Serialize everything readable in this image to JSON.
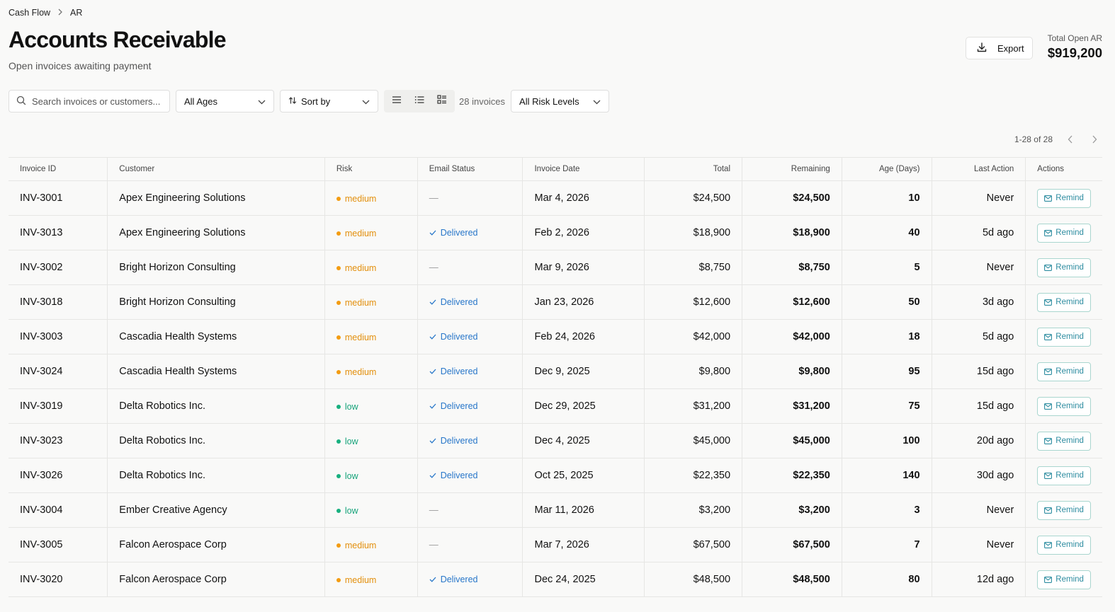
{
  "breadcrumb": {
    "items": [
      "Cash Flow",
      "AR"
    ]
  },
  "header": {
    "title": "Accounts Receivable",
    "subtitle": "Open invoices awaiting payment",
    "export_label": "Export",
    "total_label": "Total Open AR",
    "total_value": "$919,200"
  },
  "toolbar": {
    "search_placeholder": "Search invoices or customers...",
    "age_filter": "All Ages",
    "sort_label": "Sort by",
    "invoice_count": "28 invoices",
    "risk_filter": "All Risk Levels"
  },
  "pagination": {
    "range": "1-28 of 28"
  },
  "table": {
    "columns": [
      "Invoice ID",
      "Customer",
      "Risk",
      "Email Status",
      "Invoice Date",
      "Total",
      "Remaining",
      "Age (Days)",
      "Last Action",
      "Actions"
    ],
    "remind_label": "Remind",
    "rows": [
      {
        "id": "INV-3001",
        "customer": "Apex Engineering Solutions",
        "risk": "medium",
        "email": "—",
        "date": "Mar 4, 2026",
        "total": "$24,500",
        "remaining": "$24,500",
        "age": "10",
        "last": "Never"
      },
      {
        "id": "INV-3013",
        "customer": "Apex Engineering Solutions",
        "risk": "medium",
        "email": "Delivered",
        "date": "Feb 2, 2026",
        "total": "$18,900",
        "remaining": "$18,900",
        "age": "40",
        "last": "5d ago"
      },
      {
        "id": "INV-3002",
        "customer": "Bright Horizon Consulting",
        "risk": "medium",
        "email": "—",
        "date": "Mar 9, 2026",
        "total": "$8,750",
        "remaining": "$8,750",
        "age": "5",
        "last": "Never"
      },
      {
        "id": "INV-3018",
        "customer": "Bright Horizon Consulting",
        "risk": "medium",
        "email": "Delivered",
        "date": "Jan 23, 2026",
        "total": "$12,600",
        "remaining": "$12,600",
        "age": "50",
        "last": "3d ago"
      },
      {
        "id": "INV-3003",
        "customer": "Cascadia Health Systems",
        "risk": "medium",
        "email": "Delivered",
        "date": "Feb 24, 2026",
        "total": "$42,000",
        "remaining": "$42,000",
        "age": "18",
        "last": "5d ago"
      },
      {
        "id": "INV-3024",
        "customer": "Cascadia Health Systems",
        "risk": "medium",
        "email": "Delivered",
        "date": "Dec 9, 2025",
        "total": "$9,800",
        "remaining": "$9,800",
        "age": "95",
        "last": "15d ago"
      },
      {
        "id": "INV-3019",
        "customer": "Delta Robotics Inc.",
        "risk": "low",
        "email": "Delivered",
        "date": "Dec 29, 2025",
        "total": "$31,200",
        "remaining": "$31,200",
        "age": "75",
        "last": "15d ago"
      },
      {
        "id": "INV-3023",
        "customer": "Delta Robotics Inc.",
        "risk": "low",
        "email": "Delivered",
        "date": "Dec 4, 2025",
        "total": "$45,000",
        "remaining": "$45,000",
        "age": "100",
        "last": "20d ago"
      },
      {
        "id": "INV-3026",
        "customer": "Delta Robotics Inc.",
        "risk": "low",
        "email": "Delivered",
        "date": "Oct 25, 2025",
        "total": "$22,350",
        "remaining": "$22,350",
        "age": "140",
        "last": "30d ago"
      },
      {
        "id": "INV-3004",
        "customer": "Ember Creative Agency",
        "risk": "low",
        "email": "—",
        "date": "Mar 11, 2026",
        "total": "$3,200",
        "remaining": "$3,200",
        "age": "3",
        "last": "Never"
      },
      {
        "id": "INV-3005",
        "customer": "Falcon Aerospace Corp",
        "risk": "medium",
        "email": "—",
        "date": "Mar 7, 2026",
        "total": "$67,500",
        "remaining": "$67,500",
        "age": "7",
        "last": "Never"
      },
      {
        "id": "INV-3020",
        "customer": "Falcon Aerospace Corp",
        "risk": "medium",
        "email": "Delivered",
        "date": "Dec 24, 2025",
        "total": "$48,500",
        "remaining": "$48,500",
        "age": "80",
        "last": "12d ago"
      }
    ]
  },
  "colors": {
    "medium": "#e38f0c",
    "low": "#16a37a",
    "delivered": "#2776c9",
    "remind": "#2d8ca0"
  },
  "icons": [
    "chevron-right-icon",
    "download-icon",
    "search-icon",
    "chevron-down-icon",
    "sort-icon",
    "view-compact-icon",
    "view-list-icon",
    "view-grouped-icon",
    "chevron-left-icon",
    "check-icon",
    "mail-icon"
  ]
}
